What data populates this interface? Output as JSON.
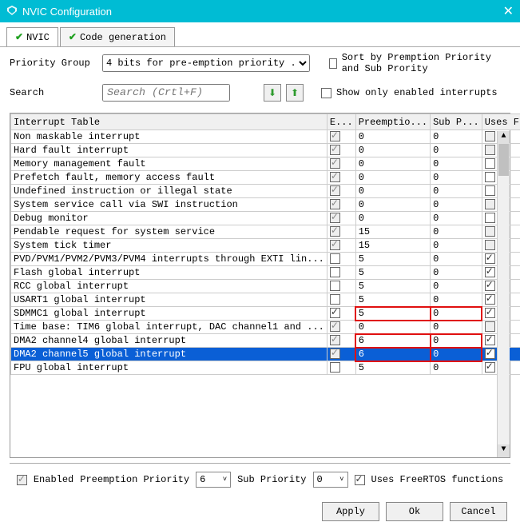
{
  "window": {
    "title": "NVIC Configuration"
  },
  "tabs": [
    {
      "label": "NVIC",
      "active": true
    },
    {
      "label": "Code generation",
      "active": false
    }
  ],
  "priority_group": {
    "label": "Priority Group",
    "value": "4 bits for pre-emption priority ..."
  },
  "sort_checkbox": {
    "label": "Sort by Premption Priority and Sub Prority",
    "checked": false
  },
  "search": {
    "label": "Search",
    "placeholder": "Search (Crtl+F)"
  },
  "show_enabled": {
    "label": "Show only enabled interrupts",
    "checked": false
  },
  "columns": {
    "name": "Interrupt Table",
    "enabled": "E...",
    "preempt": "Preemptio...",
    "sub": "Sub P...",
    "freertos": "Uses FreeRT..."
  },
  "rows": [
    {
      "name": "Non maskable interrupt",
      "en": true,
      "en_dis": true,
      "pre": "0",
      "sub": "0",
      "free": false,
      "free_dis": true
    },
    {
      "name": "Hard fault interrupt",
      "en": true,
      "en_dis": true,
      "pre": "0",
      "sub": "0",
      "free": false,
      "free_dis": true
    },
    {
      "name": "Memory management fault",
      "en": true,
      "en_dis": true,
      "pre": "0",
      "sub": "0",
      "free": false,
      "free_dis": false
    },
    {
      "name": "Prefetch fault, memory access fault",
      "en": true,
      "en_dis": true,
      "pre": "0",
      "sub": "0",
      "free": false,
      "free_dis": false
    },
    {
      "name": "Undefined instruction or illegal state",
      "en": true,
      "en_dis": true,
      "pre": "0",
      "sub": "0",
      "free": false,
      "free_dis": false
    },
    {
      "name": "System service call via SWI instruction",
      "en": true,
      "en_dis": true,
      "pre": "0",
      "sub": "0",
      "free": false,
      "free_dis": true
    },
    {
      "name": "Debug monitor",
      "en": true,
      "en_dis": true,
      "pre": "0",
      "sub": "0",
      "free": false,
      "free_dis": false
    },
    {
      "name": "Pendable request for system service",
      "en": true,
      "en_dis": true,
      "pre": "15",
      "sub": "0",
      "free": false,
      "free_dis": true
    },
    {
      "name": "System tick timer",
      "en": true,
      "en_dis": true,
      "pre": "15",
      "sub": "0",
      "free": false,
      "free_dis": true
    },
    {
      "name": "PVD/PVM1/PVM2/PVM3/PVM4 interrupts through EXTI lin...",
      "en": false,
      "en_dis": false,
      "pre": "5",
      "sub": "0",
      "free": true,
      "free_dis": false
    },
    {
      "name": "Flash global interrupt",
      "en": false,
      "en_dis": false,
      "pre": "5",
      "sub": "0",
      "free": true,
      "free_dis": false
    },
    {
      "name": "RCC global interrupt",
      "en": false,
      "en_dis": false,
      "pre": "5",
      "sub": "0",
      "free": true,
      "free_dis": false
    },
    {
      "name": "USART1 global interrupt",
      "en": false,
      "en_dis": false,
      "pre": "5",
      "sub": "0",
      "free": true,
      "free_dis": false
    },
    {
      "name": "SDMMC1 global interrupt",
      "en": true,
      "en_dis": false,
      "pre": "5",
      "sub": "0",
      "free": true,
      "free_dis": false,
      "red": true
    },
    {
      "name": "Time base: TIM6 global interrupt, DAC channel1 and ...",
      "en": true,
      "en_dis": true,
      "pre": "0",
      "sub": "0",
      "free": false,
      "free_dis": true
    },
    {
      "name": "DMA2 channel4 global interrupt",
      "en": true,
      "en_dis": true,
      "pre": "6",
      "sub": "0",
      "free": true,
      "free_dis": false,
      "red": true
    },
    {
      "name": "DMA2 channel5 global interrupt",
      "en": true,
      "en_dis": true,
      "pre": "6",
      "sub": "0",
      "free": true,
      "free_dis": false,
      "red": true,
      "selected": true
    },
    {
      "name": "FPU global interrupt",
      "en": false,
      "en_dis": false,
      "pre": "5",
      "sub": "0",
      "free": true,
      "free_dis": false
    }
  ],
  "detail": {
    "enabled_label": "Enabled",
    "enabled": true,
    "enabled_dis": true,
    "pre_label": "Preemption Priority",
    "pre_value": "6",
    "sub_label": "Sub Priority",
    "sub_value": "0",
    "free_label": "Uses FreeRTOS functions",
    "free_checked": true
  },
  "buttons": {
    "apply": "Apply",
    "ok": "Ok",
    "cancel": "Cancel"
  }
}
